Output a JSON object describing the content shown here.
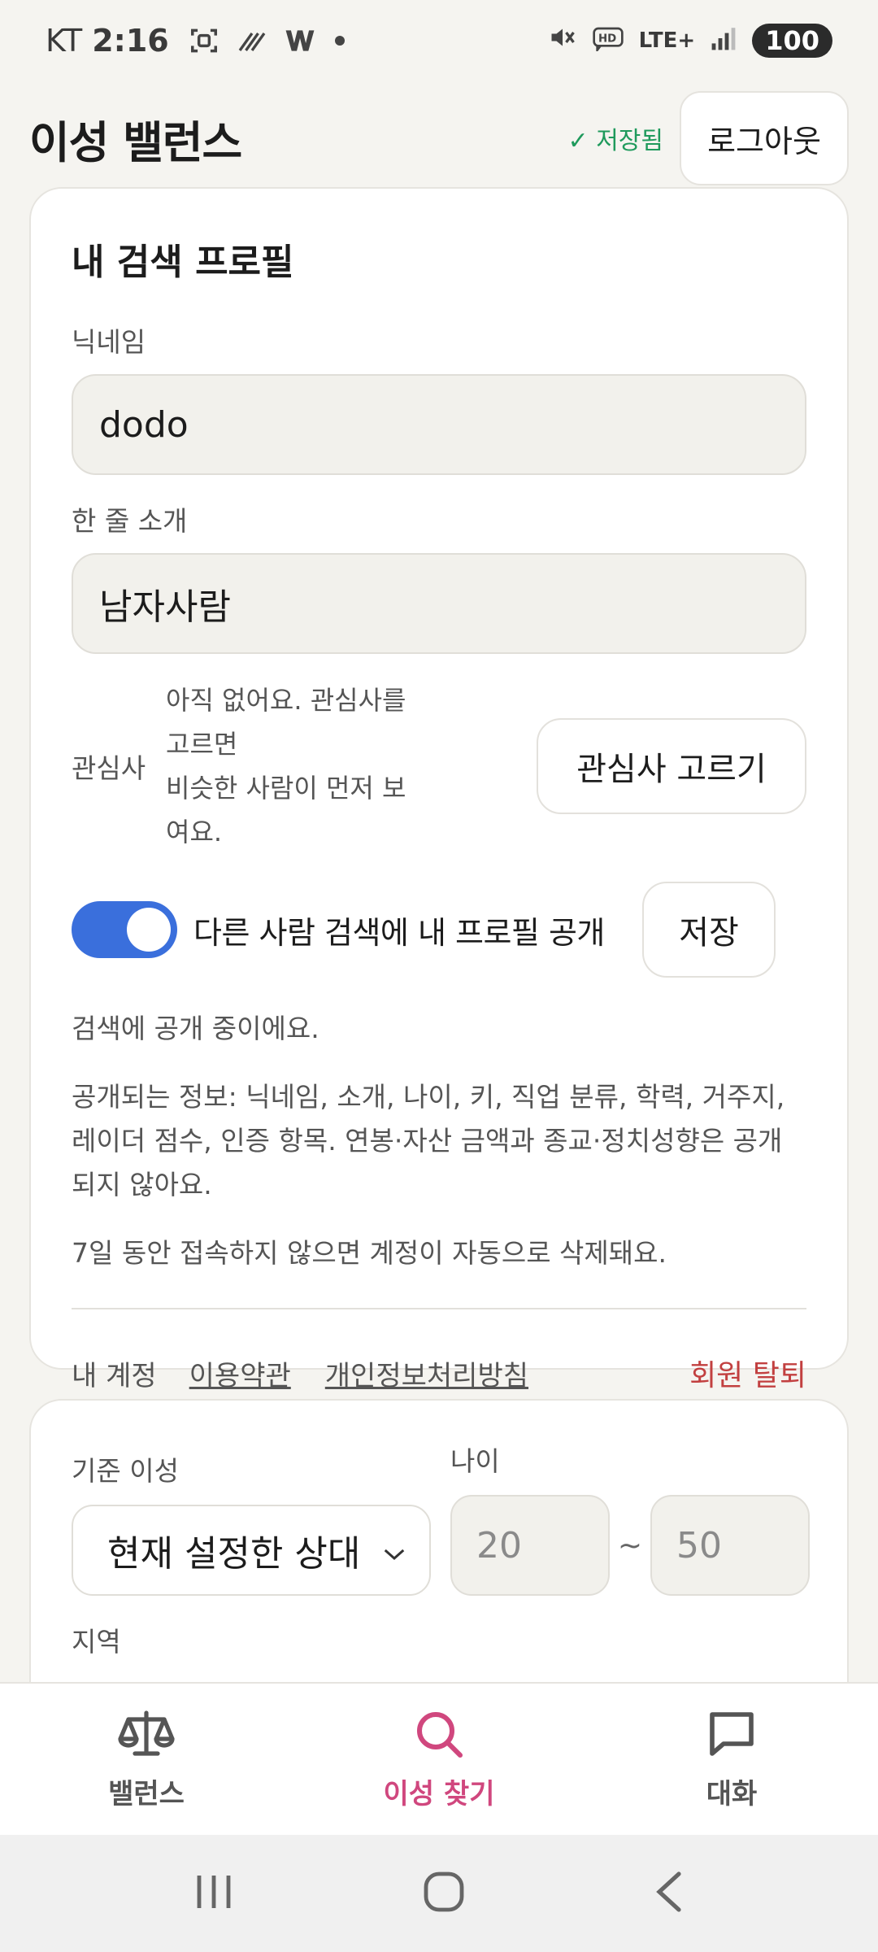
{
  "status_bar": {
    "carrier": "KT",
    "time": "2:16",
    "lte": "LTE+",
    "battery": "100",
    "icons": [
      "screenshot-icon",
      "signal-slash-icon",
      "w-app-icon",
      "dot-icon",
      "mute-icon",
      "hd-icon",
      "lte-icon",
      "signal-icon",
      "battery-icon"
    ]
  },
  "header": {
    "title": "이성 밸런스",
    "saved_status": "✓ 저장됨",
    "logout_label": "로그아웃"
  },
  "profile": {
    "section_title": "내 검색 프로필",
    "nickname_label": "닉네임",
    "nickname_value": "dodo",
    "intro_label": "한 줄 소개",
    "intro_value": "남자사람",
    "interests_label": "관심사",
    "interests_empty_line1": "아직 없어요. 관심사를 고르면",
    "interests_empty_line2": "비슷한 사람이 먼저 보여요.",
    "interests_button": "관심사 고르기",
    "public_toggle_label": "다른 사람 검색에 내 프로필 공개",
    "public_toggle_on": true,
    "save_button": "저장",
    "public_status": "검색에 공개 중이에요.",
    "disclosure_info": "공개되는 정보: 닉네임, 소개, 나이, 키, 직업 분류, 학력, 거주지, 레이더 점수, 인증 항목. 연봉·자산 금액과 종교·정치성향은 공개되지 않아요.",
    "auto_delete_notice": "7일 동안 접속하지 않으면 계정이 자동으로 삭제돼요."
  },
  "account": {
    "label": "내 계정",
    "terms_link": "이용약관",
    "privacy_link": "개인정보처리방침",
    "withdraw_label": "회원 탈퇴"
  },
  "filters": {
    "basis_label": "기준 이성",
    "basis_value": "현재 설정한 상대",
    "age_label": "나이",
    "age_min": "20",
    "age_separator": "~",
    "age_max": "50",
    "region_label": "지역"
  },
  "bottom_nav": {
    "items": [
      {
        "label": "밸런스",
        "icon": "balance-scale-icon",
        "active": false
      },
      {
        "label": "이성 찾기",
        "icon": "search-icon",
        "active": true
      },
      {
        "label": "대화",
        "icon": "chat-bubble-icon",
        "active": false
      }
    ]
  },
  "colors": {
    "accent": "#d0477e",
    "toggle_on": "#3a6fdc",
    "saved_green": "#1f9a5c",
    "danger": "#c24040"
  }
}
